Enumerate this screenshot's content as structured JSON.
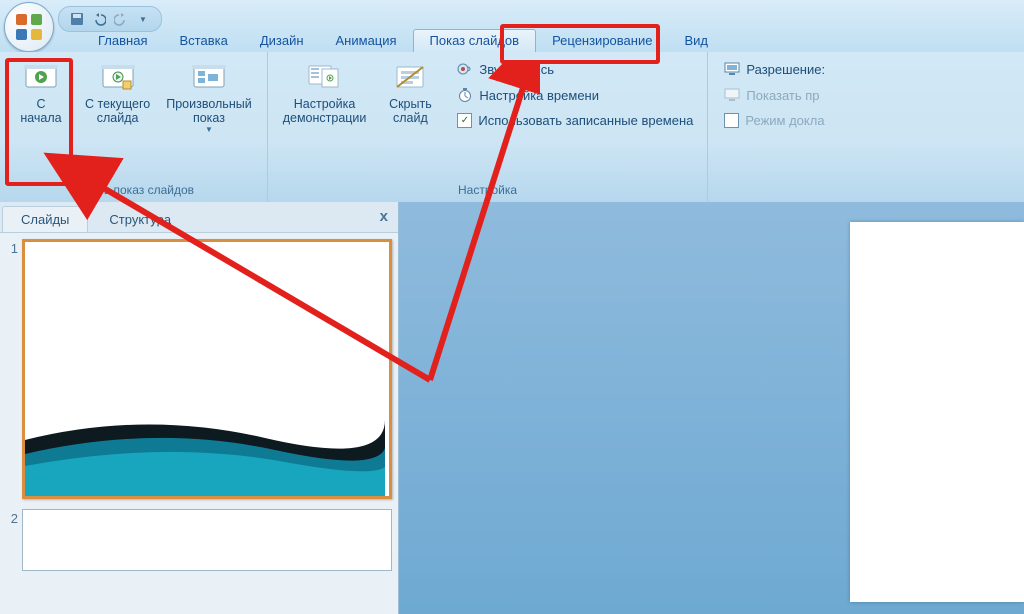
{
  "colors": {
    "highlight": "#e3211c",
    "link": "#14539f"
  },
  "qat": {
    "items": [
      "save",
      "undo",
      "redo",
      "dropdown"
    ]
  },
  "tabs": [
    {
      "id": "home",
      "label": "Главная"
    },
    {
      "id": "insert",
      "label": "Вставка"
    },
    {
      "id": "design",
      "label": "Дизайн"
    },
    {
      "id": "animation",
      "label": "Анимация"
    },
    {
      "id": "slideshow",
      "label": "Показ слайдов",
      "active": true
    },
    {
      "id": "review",
      "label": "Рецензирование"
    },
    {
      "id": "view",
      "label": "Вид"
    }
  ],
  "ribbon": {
    "group1": {
      "label": "Начать показ слайдов",
      "btn_from_start": "С\nначала",
      "btn_from_current": "С текущего\nслайда",
      "btn_custom": "Произвольный\nпоказ"
    },
    "group2": {
      "label": "Настройка",
      "btn_setup": "Настройка\nдемонстрации",
      "btn_hide": "Скрыть\nслайд",
      "row_record": "Звукозапись",
      "row_rehearse": "Настройка времени",
      "row_usetimings": "Использовать записанные времена",
      "usetimings_checked": true
    },
    "group3": {
      "row_resolution": "Разрешение:",
      "row_showon": "Показать пр",
      "row_presenter": "Режим докла"
    }
  },
  "pane": {
    "tab_slides": "Слайды",
    "tab_outline": "Структура",
    "close": "x",
    "thumbs": [
      {
        "n": "1"
      },
      {
        "n": "2"
      }
    ]
  }
}
